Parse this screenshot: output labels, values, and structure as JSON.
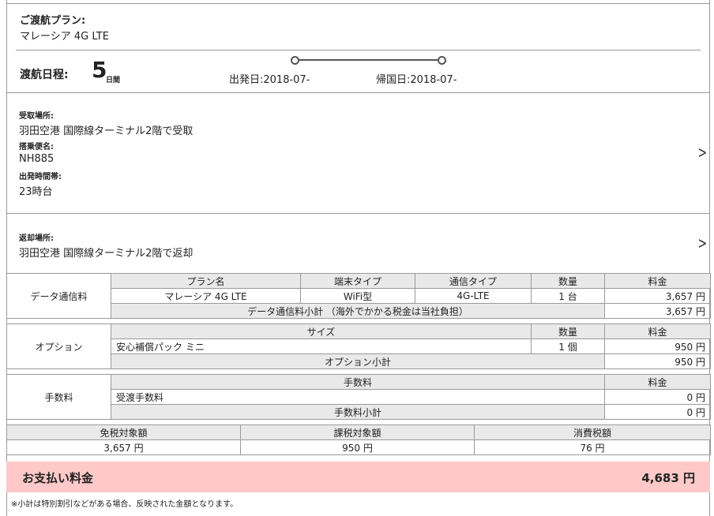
{
  "plan": {
    "label": "ご渡航プラン:",
    "value": "マレーシア 4G LTE"
  },
  "travel": {
    "label": "渡航日程:",
    "days": "5",
    "days_unit": "日間",
    "depart": "出発日:2018-07-",
    "return": "帰国日:2018-07-"
  },
  "pickup": {
    "place_label": "受取場所:",
    "place": "羽田空港 国際線ターミナル2階で受取",
    "flight_label": "搭乗便名:",
    "flight": "NH885",
    "time_label": "出発時間帯:",
    "time": "23時台"
  },
  "return_place": {
    "label": "返却場所:",
    "value": "羽田空港 国際線ターミナル2階で返却"
  },
  "data_fee": {
    "side": "データ通信料",
    "headers": [
      "プラン名",
      "端末タイプ",
      "通信タイプ",
      "数量",
      "料金"
    ],
    "row": [
      "マレーシア 4G LTE",
      "WiFi型",
      "4G-LTE",
      "1 台",
      "3,657 円"
    ],
    "subtotal_label": "データ通信料小計 （海外でかかる税金は当社負担）",
    "subtotal": "3,657 円"
  },
  "option": {
    "side": "オプション",
    "headers": [
      "サイズ",
      "数量",
      "料金"
    ],
    "row": [
      "安心補償パック ミニ",
      "1 個",
      "950 円"
    ],
    "subtotal_label": "オプション小計",
    "subtotal": "950 円"
  },
  "fee": {
    "side": "手数料",
    "headers": [
      "手数料",
      "料金"
    ],
    "row": [
      "受渡手数料",
      "0 円"
    ],
    "subtotal_label": "手数料小計",
    "subtotal": "0 円"
  },
  "tax": {
    "headers": [
      "免税対象額",
      "課税対象額",
      "消費税額"
    ],
    "values": [
      "3,657 円",
      "950 円",
      "76 円"
    ]
  },
  "payment": {
    "label": "お支払い料金",
    "amount": "4,683 円"
  },
  "note": "※小計は特別割引などがある場合、反映された金額となります。"
}
